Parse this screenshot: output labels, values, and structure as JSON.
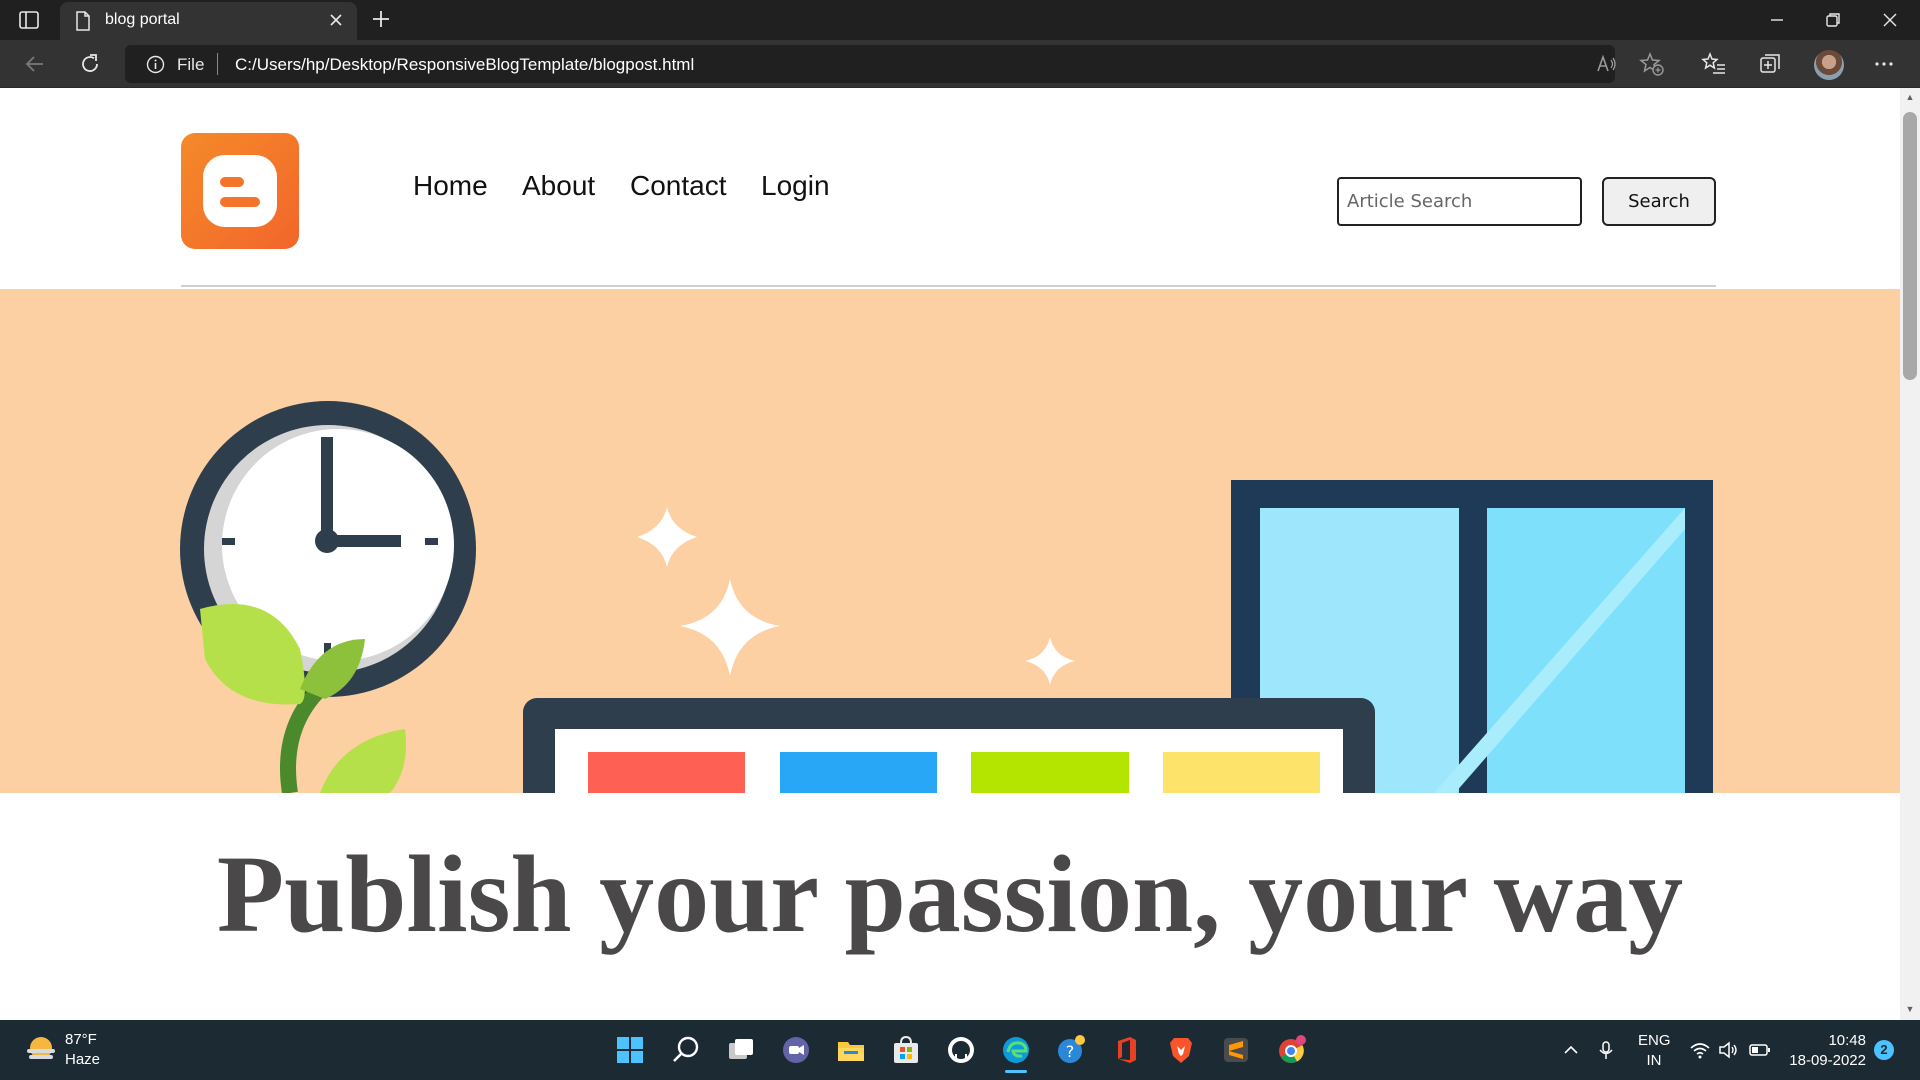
{
  "browser": {
    "tab_title": "blog portal",
    "scheme_label": "File",
    "url": "C:/Users/hp/Desktop/ResponsiveBlogTemplate/blogpost.html"
  },
  "site": {
    "nav": [
      "Home",
      "About",
      "Contact",
      "Login"
    ],
    "search_placeholder": "Article Search",
    "search_button": "Search",
    "headline": "Publish your passion, your way",
    "colors": {
      "hero_background": "#fcd0a3",
      "logo_orange": "#f4742b",
      "headline": "#4a4848"
    }
  },
  "taskbar": {
    "temperature": "87°F",
    "weather": "Haze",
    "language_line1": "ENG",
    "language_line2": "IN",
    "time": "10:48",
    "date": "18-09-2022",
    "notification_count": "2"
  }
}
